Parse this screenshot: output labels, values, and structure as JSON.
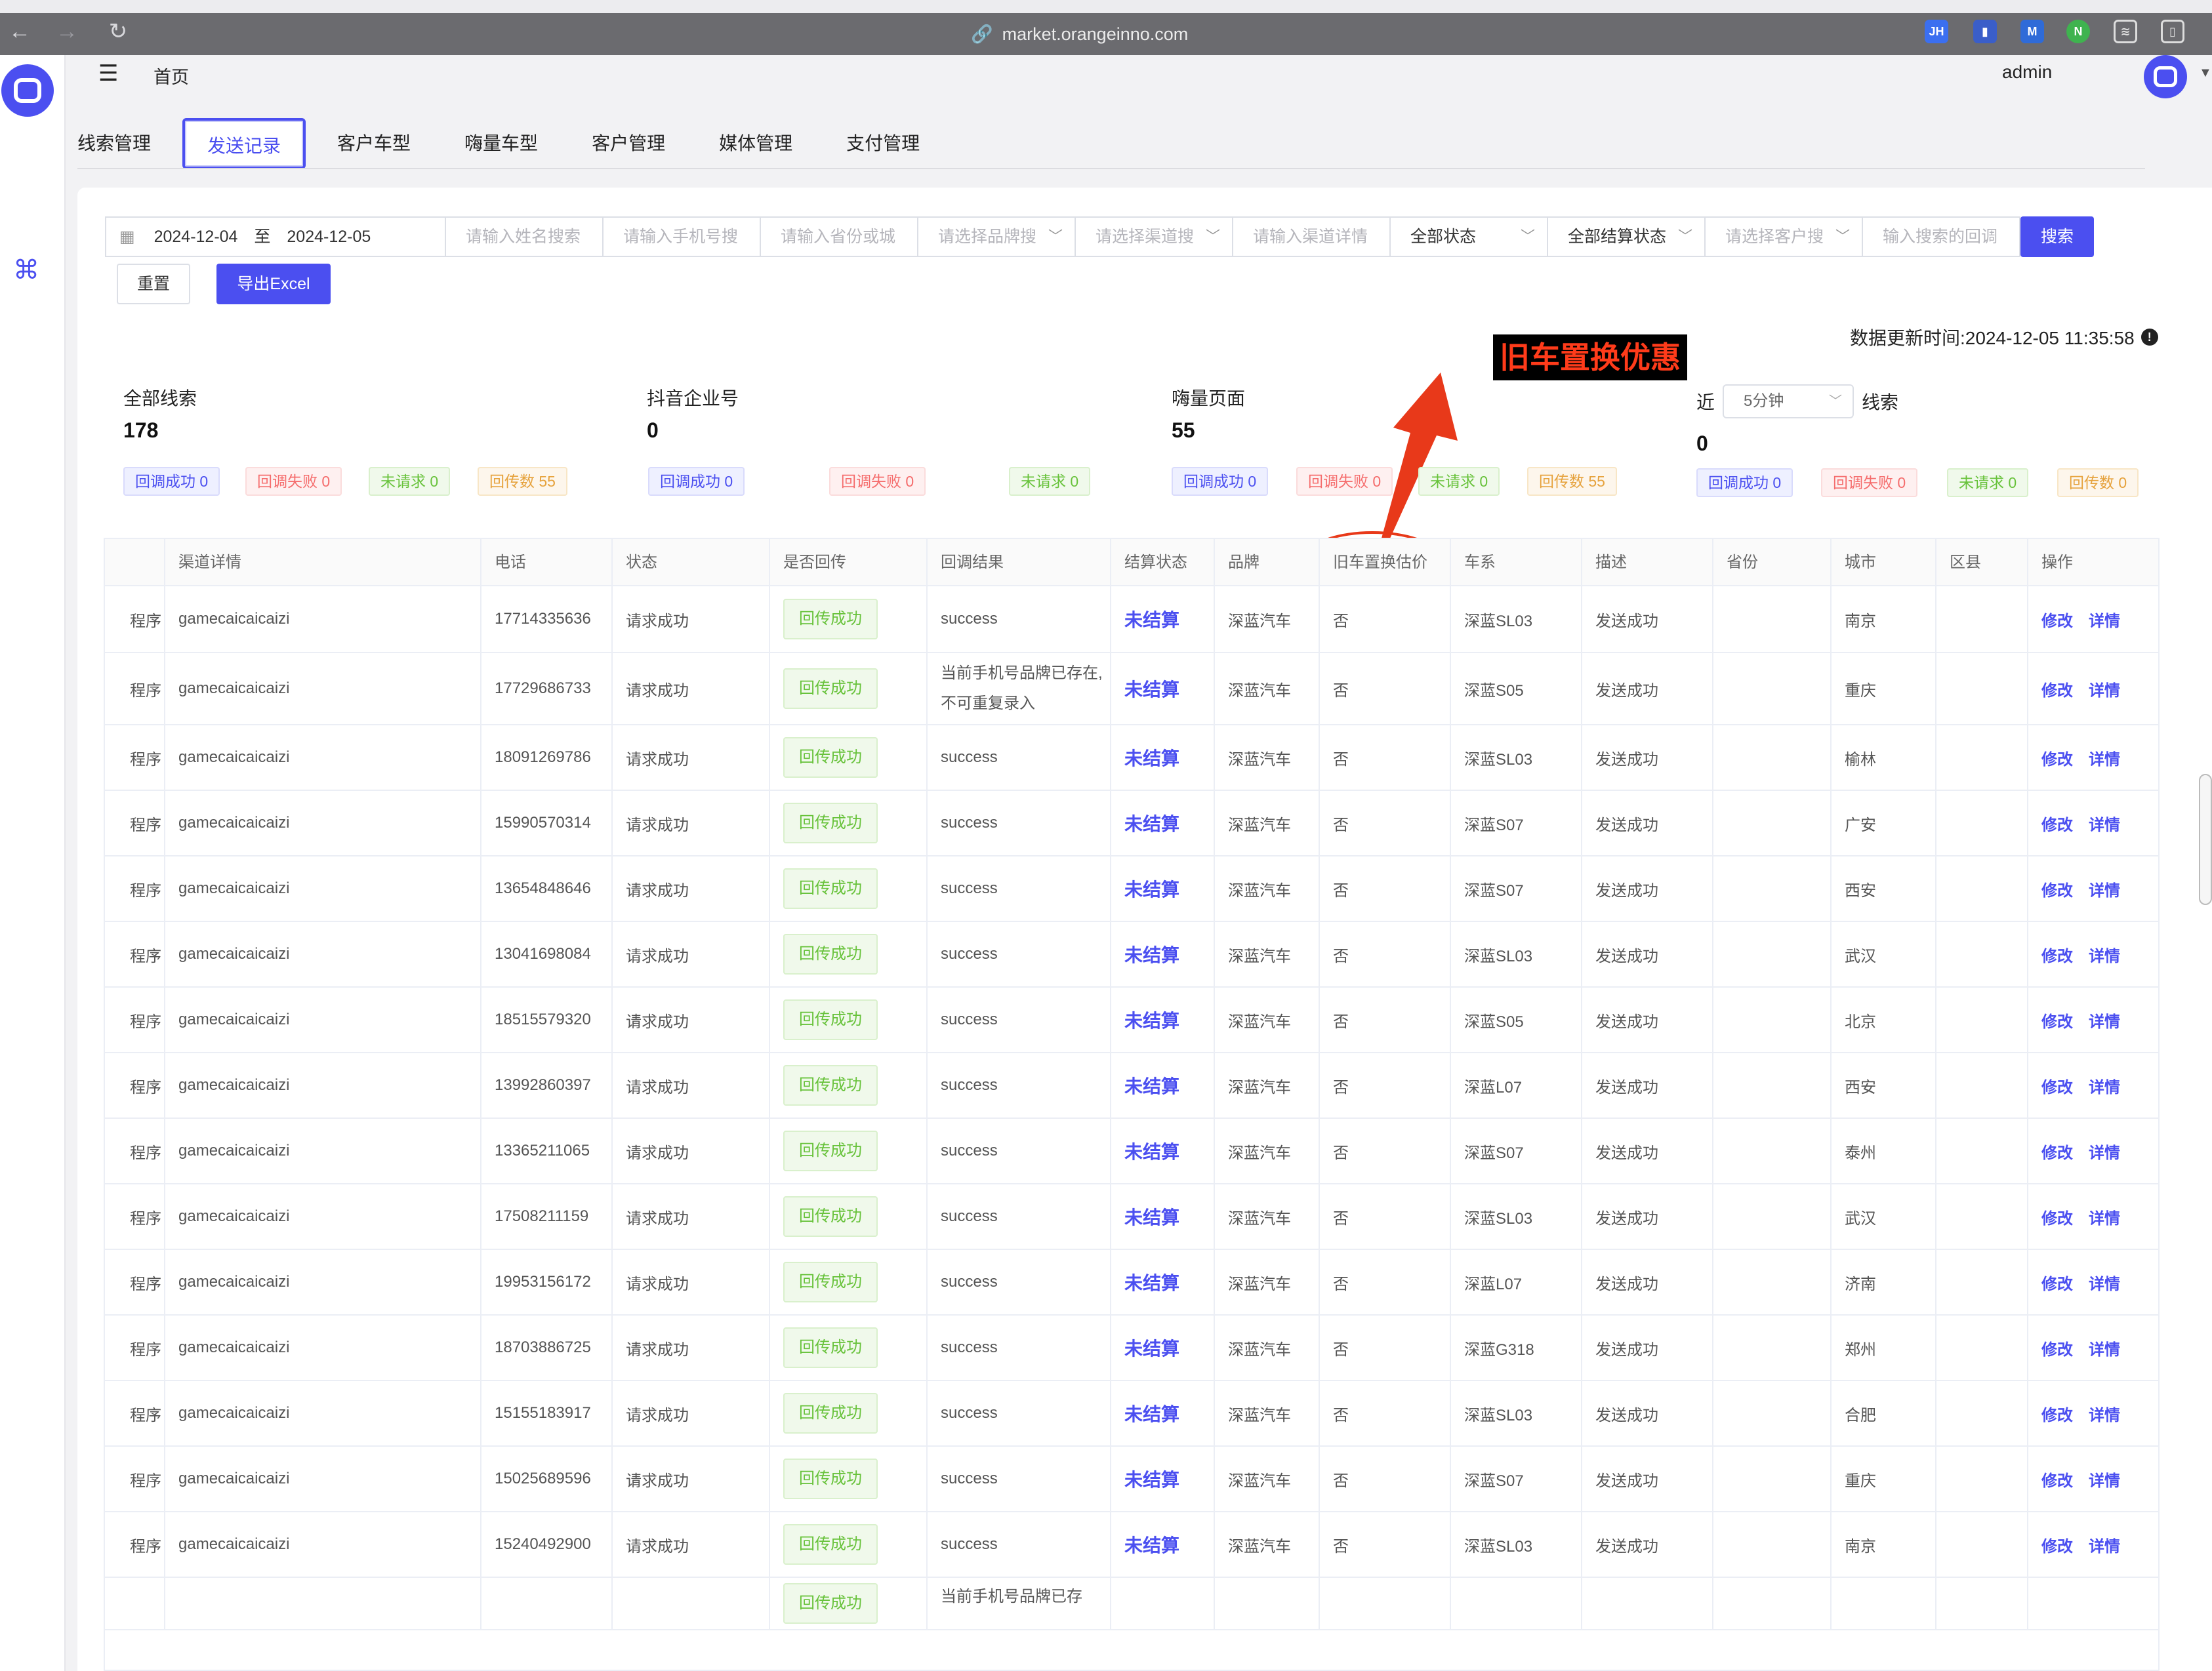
{
  "browser": {
    "url": "market.orangeinno.com"
  },
  "header": {
    "home_label": "首页",
    "user_name": "admin"
  },
  "tabs": [
    {
      "label": "线索管理",
      "active": false
    },
    {
      "label": "发送记录",
      "active": true
    },
    {
      "label": "客户车型",
      "active": false
    },
    {
      "label": "嗨量车型",
      "active": false
    },
    {
      "label": "客户管理",
      "active": false
    },
    {
      "label": "媒体管理",
      "active": false
    },
    {
      "label": "支付管理",
      "active": false
    }
  ],
  "filters": {
    "date_start": "2024-12-04",
    "date_sep": "至",
    "date_end": "2024-12-05",
    "name_placeholder": "请输入姓名搜索",
    "phone_placeholder": "请输入手机号搜",
    "province_placeholder": "请输入省份或城",
    "brand_placeholder": "请选择品牌搜",
    "channel_placeholder": "请选择渠道搜",
    "channel_detail_placeholder": "请输入渠道详情",
    "status_value": "全部状态",
    "settle_value": "全部结算状态",
    "customer_placeholder": "请选择客户搜",
    "callback_placeholder": "输入搜索的回调",
    "search_label": "搜索",
    "reset_label": "重置",
    "export_label": "导出Excel"
  },
  "update_time": "数据更新时间:2024-12-05 11:35:58",
  "annotation": "旧车置换优惠",
  "stats": [
    {
      "title": "全部线索",
      "value": "178",
      "tags": [
        "回调成功 0",
        "回调失败 0",
        "未请求 0",
        "回传数 55"
      ]
    },
    {
      "title": "抖音企业号",
      "value": "0",
      "tags": [
        "回调成功 0",
        "回调失败 0",
        "未请求 0"
      ]
    },
    {
      "title": "嗨量页面",
      "value": "55",
      "tags": [
        "回调成功 0",
        "回调失败 0",
        "未请求 0",
        "回传数 55"
      ]
    }
  ],
  "near": {
    "prefix": "近",
    "interval": "5分钟",
    "suffix": "线索",
    "value": "0",
    "tags": [
      "回调成功 0",
      "回调失败 0",
      "未请求 0",
      "回传数 0"
    ]
  },
  "table": {
    "headers": [
      "",
      "渠道详情",
      "电话",
      "状态",
      "是否回传",
      "回调结果",
      "结算状态",
      "品牌",
      "旧车置换估价",
      "车系",
      "描述",
      "省份",
      "城市",
      "区县",
      "操作"
    ],
    "edit_label": "修改",
    "detail_label": "详情",
    "rows": [
      [
        "程序",
        "gamecaicaicaizi",
        "17714335636",
        "请求成功",
        "回传成功",
        "success",
        "未结算",
        "深蓝汽车",
        "否",
        "深蓝SL03",
        "发送成功",
        "",
        "南京",
        ""
      ],
      [
        "程序",
        "gamecaicaicaizi",
        "17729686733",
        "请求成功",
        "回传成功",
        "当前手机号品牌已存在,不可重复录入",
        "未结算",
        "深蓝汽车",
        "否",
        "深蓝S05",
        "发送成功",
        "",
        "重庆",
        ""
      ],
      [
        "程序",
        "gamecaicaicaizi",
        "18091269786",
        "请求成功",
        "回传成功",
        "success",
        "未结算",
        "深蓝汽车",
        "否",
        "深蓝SL03",
        "发送成功",
        "",
        "榆林",
        ""
      ],
      [
        "程序",
        "gamecaicaicaizi",
        "15990570314",
        "请求成功",
        "回传成功",
        "success",
        "未结算",
        "深蓝汽车",
        "否",
        "深蓝S07",
        "发送成功",
        "",
        "广安",
        ""
      ],
      [
        "程序",
        "gamecaicaicaizi",
        "13654848646",
        "请求成功",
        "回传成功",
        "success",
        "未结算",
        "深蓝汽车",
        "否",
        "深蓝S07",
        "发送成功",
        "",
        "西安",
        ""
      ],
      [
        "程序",
        "gamecaicaicaizi",
        "13041698084",
        "请求成功",
        "回传成功",
        "success",
        "未结算",
        "深蓝汽车",
        "否",
        "深蓝SL03",
        "发送成功",
        "",
        "武汉",
        ""
      ],
      [
        "程序",
        "gamecaicaicaizi",
        "18515579320",
        "请求成功",
        "回传成功",
        "success",
        "未结算",
        "深蓝汽车",
        "否",
        "深蓝S05",
        "发送成功",
        "",
        "北京",
        ""
      ],
      [
        "程序",
        "gamecaicaicaizi",
        "13992860397",
        "请求成功",
        "回传成功",
        "success",
        "未结算",
        "深蓝汽车",
        "否",
        "深蓝L07",
        "发送成功",
        "",
        "西安",
        ""
      ],
      [
        "程序",
        "gamecaicaicaizi",
        "13365211065",
        "请求成功",
        "回传成功",
        "success",
        "未结算",
        "深蓝汽车",
        "否",
        "深蓝S07",
        "发送成功",
        "",
        "泰州",
        ""
      ],
      [
        "程序",
        "gamecaicaicaizi",
        "17508211159",
        "请求成功",
        "回传成功",
        "success",
        "未结算",
        "深蓝汽车",
        "否",
        "深蓝SL03",
        "发送成功",
        "",
        "武汉",
        ""
      ],
      [
        "程序",
        "gamecaicaicaizi",
        "19953156172",
        "请求成功",
        "回传成功",
        "success",
        "未结算",
        "深蓝汽车",
        "否",
        "深蓝L07",
        "发送成功",
        "",
        "济南",
        ""
      ],
      [
        "程序",
        "gamecaicaicaizi",
        "18703886725",
        "请求成功",
        "回传成功",
        "success",
        "未结算",
        "深蓝汽车",
        "否",
        "深蓝G318",
        "发送成功",
        "",
        "郑州",
        ""
      ],
      [
        "程序",
        "gamecaicaicaizi",
        "15155183917",
        "请求成功",
        "回传成功",
        "success",
        "未结算",
        "深蓝汽车",
        "否",
        "深蓝SL03",
        "发送成功",
        "",
        "合肥",
        ""
      ],
      [
        "程序",
        "gamecaicaicaizi",
        "15025689596",
        "请求成功",
        "回传成功",
        "success",
        "未结算",
        "深蓝汽车",
        "否",
        "深蓝S07",
        "发送成功",
        "",
        "重庆",
        ""
      ],
      [
        "程序",
        "gamecaicaicaizi",
        "15240492900",
        "请求成功",
        "回传成功",
        "success",
        "未结算",
        "深蓝汽车",
        "否",
        "深蓝SL03",
        "发送成功",
        "",
        "南京",
        ""
      ],
      [
        "",
        "",
        "",
        "",
        "回传成功",
        "当前手机号品牌已存",
        "",
        "",
        "",
        "",
        "",
        "",
        "",
        ""
      ]
    ]
  },
  "colors": {
    "accent": "#4b4ff0",
    "success_green": "#67c23a",
    "fail_red": "#f56c6c",
    "count_orange": "#e6a23c",
    "annotation_red": "#e8391a"
  }
}
